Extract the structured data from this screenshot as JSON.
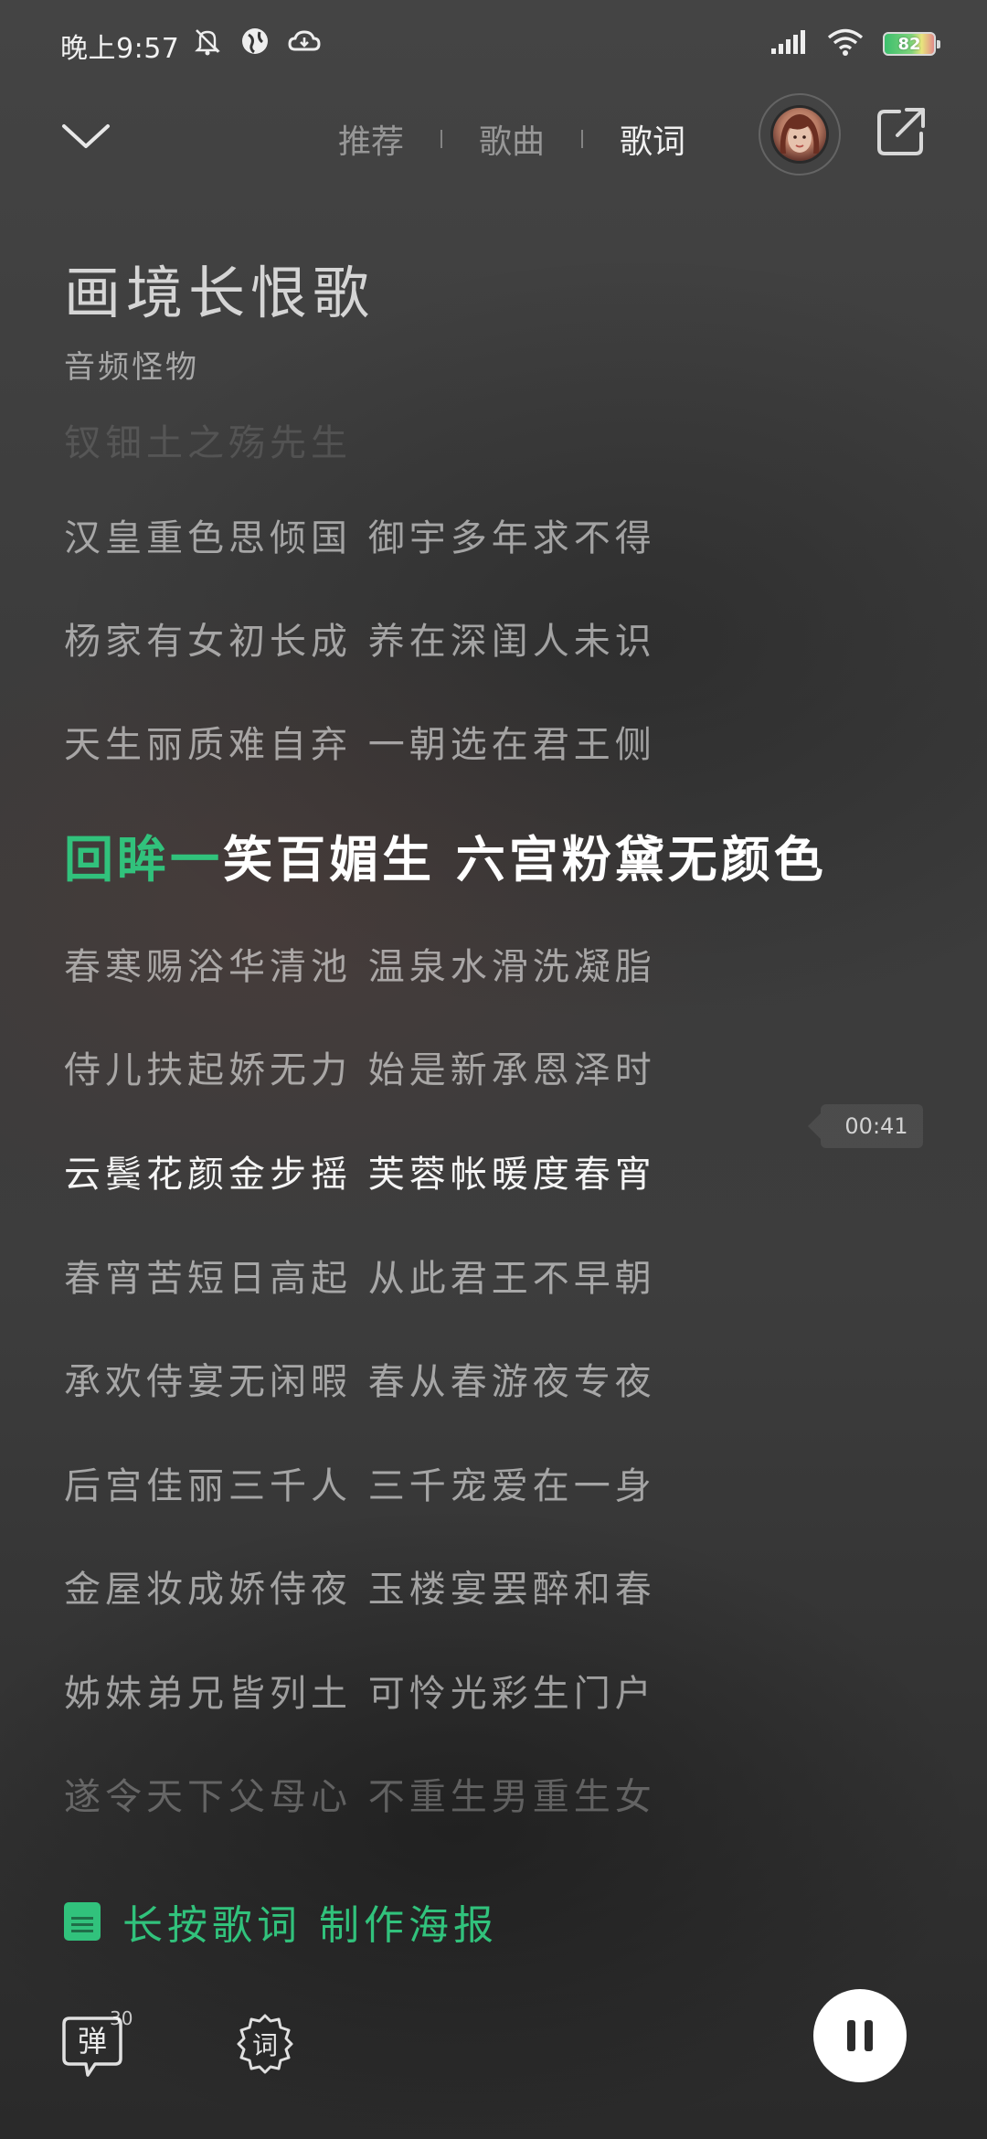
{
  "status_bar": {
    "time": "晚上9:57",
    "battery": "82",
    "icons": [
      "mute-icon",
      "vpn-icon",
      "cloud-icon",
      "signal-icon",
      "wifi-icon",
      "battery-icon"
    ]
  },
  "header": {
    "tabs": [
      {
        "label": "推荐",
        "active": false
      },
      {
        "label": "歌曲",
        "active": false
      },
      {
        "label": "歌词",
        "active": true
      }
    ]
  },
  "song": {
    "title": "画境长恨歌",
    "artist": "音频怪物",
    "lyric_prev_faded": "钗钿土之殇先生"
  },
  "lyrics": {
    "lines": [
      "汉皇重色思倾国 御宇多年求不得",
      "杨家有女初长成 养在深闺人未识",
      "天生丽质难自弃 一朝选在君王侧"
    ],
    "current_sung": "回眸一",
    "current_rest": "笑百媚生 六宫粉黛无颜色",
    "after": [
      "春寒赐浴华清池 温泉水滑洗凝脂",
      "侍儿扶起娇无力 始是新承恩泽时",
      "云鬓花颜金步摇 芙蓉帐暖度春宵",
      "春宵苦短日高起 从此君王不早朝",
      "承欢侍宴无闲暇 春从春游夜专夜",
      "后宫佳丽三千人 三千宠爱在一身",
      "金屋妆成娇侍夜 玉楼宴罢醉和春",
      "姊妹弟兄皆列土 可怜光彩生门户",
      "遂令天下父母心 不重生男重生女"
    ],
    "seek_time": "00:41"
  },
  "poster_tip": "长按歌词 制作海报",
  "bottom": {
    "danmu_label": "弹",
    "danmu_count": "30",
    "lyric_label": "词"
  },
  "colors": {
    "accent": "#31c27c",
    "background": "#3a3a3a"
  }
}
